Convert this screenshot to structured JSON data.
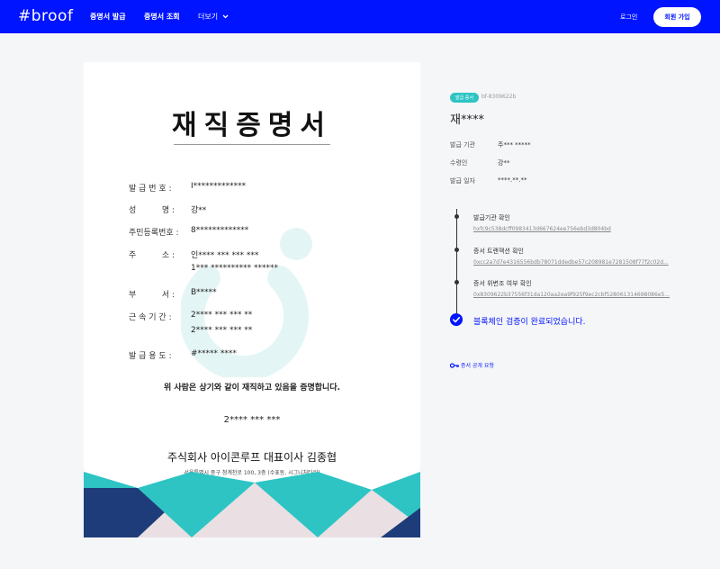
{
  "header": {
    "logo": "#broof",
    "nav": [
      "증명서 발급",
      "증명서 조회"
    ],
    "more": "더보기",
    "login": "로그인",
    "signup": "회원 가입"
  },
  "certificate": {
    "title": "재직증명서",
    "rows": [
      {
        "label": "발 급 번 호 :",
        "value": "I*************"
      },
      {
        "label": "성          명 :",
        "value": "강**"
      },
      {
        "label": "주민등록번호 :",
        "value": "8*************"
      },
      {
        "label": "주          소 :",
        "value": "인**** *** *** ***"
      },
      {
        "label": "",
        "value": "1*** ********** ******"
      },
      {
        "label": "부          서 :",
        "value": "B*****"
      },
      {
        "label": "근 속 기 간 :",
        "value": "2**** *** *** **"
      },
      {
        "label": "",
        "value": "2**** *** *** **"
      },
      {
        "label": "발 급 용 도 :",
        "value": "#***** ****"
      }
    ],
    "statement": "위 사람은 상기와 같이 재직하고 있음을 증명합니다.",
    "date": "2**** *** ***",
    "company": "주식회사 아이콘루프  대표이사 김종협",
    "address": "서울특별시 중구 청계천로 100, 3층 (수표동, 시그니처타워)"
  },
  "panel": {
    "badge": "발급 증서",
    "code": "bf-8309622b",
    "doc_name": "재****",
    "info": [
      {
        "label": "발급 기관",
        "value": "주*** *****"
      },
      {
        "label": "수령인",
        "value": "강**"
      },
      {
        "label": "발급 일자",
        "value": "****.**.**"
      }
    ],
    "timeline": [
      {
        "label": "발급기관 확인",
        "hash": "hxfc9c538dcff0983413d667624ee756ebd3d804bd"
      },
      {
        "label": "증서 트랜잭션 확인",
        "hash": "0xcc2a7d7e4316556bdb78071ddedbe57c208981e7281508f77f2c02d..."
      },
      {
        "label": "증서 위변조 여부 확인",
        "hash": "0x8309622b37556f31da120aa2ea9f925f9ec2cbf528061314698086e5..."
      }
    ],
    "verified": "블록체인 검증이 완료되었습니다.",
    "public_request": "증서 공개 요청"
  },
  "colors": {
    "brand": "#0014ff",
    "teal": "#2ec4c4",
    "navy": "#1f3c7a",
    "pink": "#eadfe3"
  }
}
